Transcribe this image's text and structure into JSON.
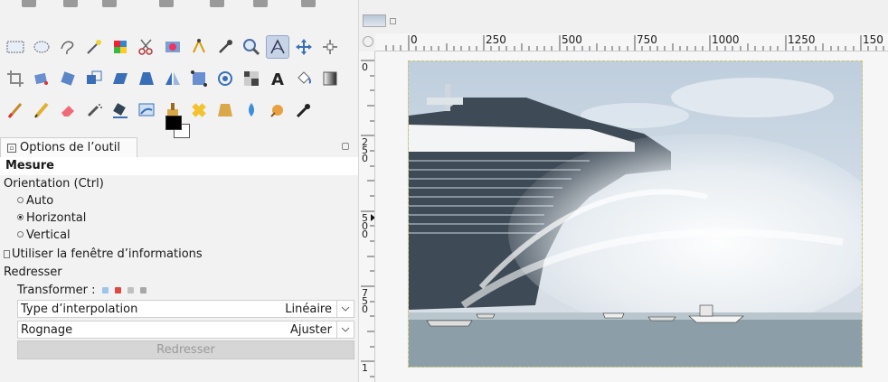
{
  "toolbox": {
    "tools": [
      [
        "rect-select",
        "ellipse-select",
        "free-select",
        "fuzzy-select",
        "color-select",
        "scissors",
        "foreground-select",
        "paths",
        "color-picker",
        "zoom",
        "measure",
        "move",
        "align"
      ],
      [
        "crop",
        "unified-transform",
        "rotate",
        "scale",
        "shear",
        "perspective",
        "flip",
        "cage",
        "warp",
        "handle",
        "text",
        "bucket-fill",
        "gradient"
      ],
      [
        "paintbrush",
        "pencil",
        "eraser",
        "airbrush",
        "ink",
        "mypaint",
        "clone",
        "heal",
        "perspective-clone",
        "smudge",
        "dodge",
        "blur"
      ]
    ],
    "active_tool": "measure"
  },
  "tool_options": {
    "tab_label": "Options de l’outil",
    "tool_title": "Mesure",
    "orientation_label": "Orientation  (Ctrl)",
    "orientation_options": [
      "Auto",
      "Horizontal",
      "Vertical"
    ],
    "orientation_selected": "Horizontal",
    "info_window_label": "Utiliser la fenêtre d’informations",
    "straighten_label": "Redresser",
    "transform_label": "Transformer :",
    "interpolation_label": "Type d’interpolation",
    "interpolation_value": "Linéaire",
    "clipping_label": "Rognage",
    "clipping_value": "Ajuster",
    "straighten_button": "Redresser"
  },
  "image_window": {
    "ruler_h_labels": [
      "0",
      "250",
      "500",
      "750",
      "1000",
      "1250",
      "150"
    ],
    "ruler_v_labels": [
      "0",
      "250",
      "500",
      "750",
      "1"
    ]
  },
  "colors": {
    "active_tool_bg": "#c7d3e6",
    "selection_border": "#c9c56c"
  }
}
